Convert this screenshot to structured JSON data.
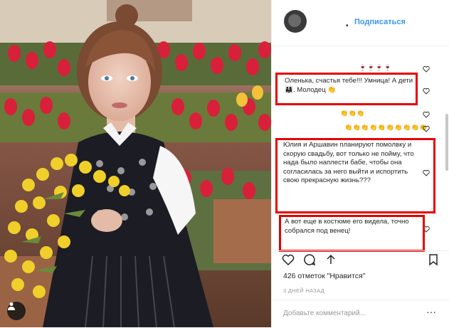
{
  "header": {
    "follow_label": "Подписаться",
    "dot": "•"
  },
  "comments": [
    {
      "text": "🍷🍷🍷🍷"
    },
    {
      "text": "Оленька, счастья тебе!!! Умница! А дети 👨‍👩‍👧. Молодец 👏"
    },
    {
      "text": "👏👏👏"
    },
    {
      "text": "👏👏👏👏👏👏👏👏👏👏"
    },
    {
      "text": "Юлия и Аршавин планируют помолвку и скорую свадьбу, вот только не пойму, что нада было наплести бабе, чтобы она согласилась за него выйти и испортить свою прекрасную жизнь???"
    },
    {
      "text": "А вот еще в костюме его видела, точно собрался под венец!"
    }
  ],
  "likes": {
    "count": "426",
    "text": "426 отметок \"Нравится\""
  },
  "time_ago": "3 ДНЕЙ НАЗАД",
  "comment_input": {
    "placeholder": "Добавьте комментарий..."
  },
  "more_label": "···",
  "colors": {
    "accent": "#3897f0",
    "highlight_box": "#e60000",
    "text": "#262626",
    "muted": "#999999"
  },
  "icons": [
    "heart-icon",
    "comment-icon",
    "share-icon",
    "bookmark-icon",
    "user-tag-icon"
  ]
}
